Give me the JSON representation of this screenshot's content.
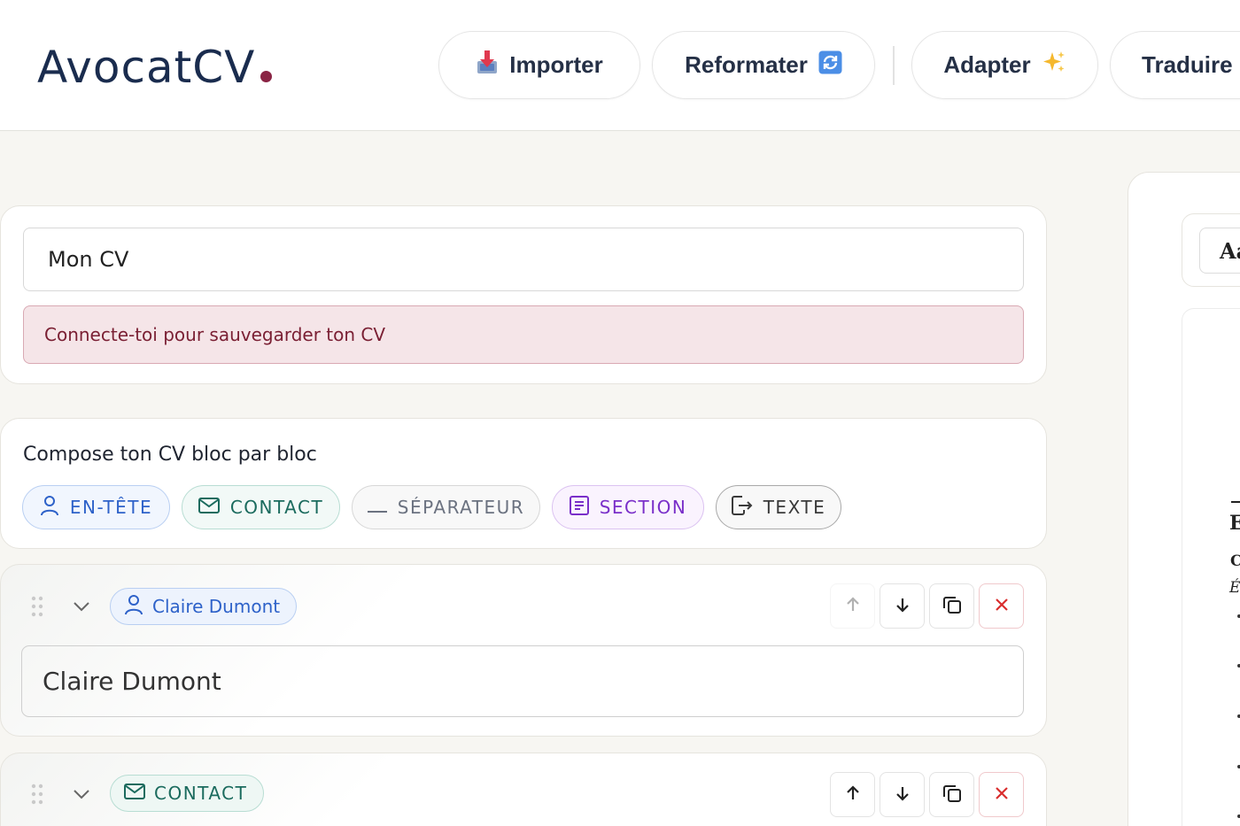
{
  "brand": {
    "name": "AvocatCV",
    "accent": "#8a2444",
    "color": "#1a2c4e"
  },
  "nav": {
    "import_label": "Importer",
    "reformat_label": "Reformater",
    "adapt_label": "Adapter",
    "translate_label": "Traduire"
  },
  "cv": {
    "title_value": "Mon CV",
    "login_notice": "Connecte-toi pour sauvegarder ton CV"
  },
  "compose": {
    "heading": "Compose ton CV bloc par bloc",
    "chips": {
      "header": "EN-TÊTE",
      "contact": "CONTACT",
      "separator": "SÉPARATEUR",
      "section": "SECTION",
      "text": "TEXTE"
    }
  },
  "blocks": [
    {
      "type": "header",
      "chip_label": "Claire Dumont",
      "input_value": "Claire Dumont",
      "move_up_enabled": false
    },
    {
      "type": "contact",
      "chip_label": "CONTACT",
      "move_up_enabled": true
    }
  ],
  "preview": {
    "font_button": "Aa",
    "fragments": {
      "line1": "E",
      "line2": "C",
      "line3": "É"
    }
  },
  "icons": [
    "import-tray-icon",
    "refresh-icon",
    "sparkles-icon",
    "user-icon",
    "mail-icon",
    "minus-icon",
    "section-icon",
    "text-insert-icon",
    "drag-handle-icon",
    "chevron-down-icon",
    "arrow-up-icon",
    "arrow-down-icon",
    "duplicate-icon",
    "delete-icon"
  ]
}
